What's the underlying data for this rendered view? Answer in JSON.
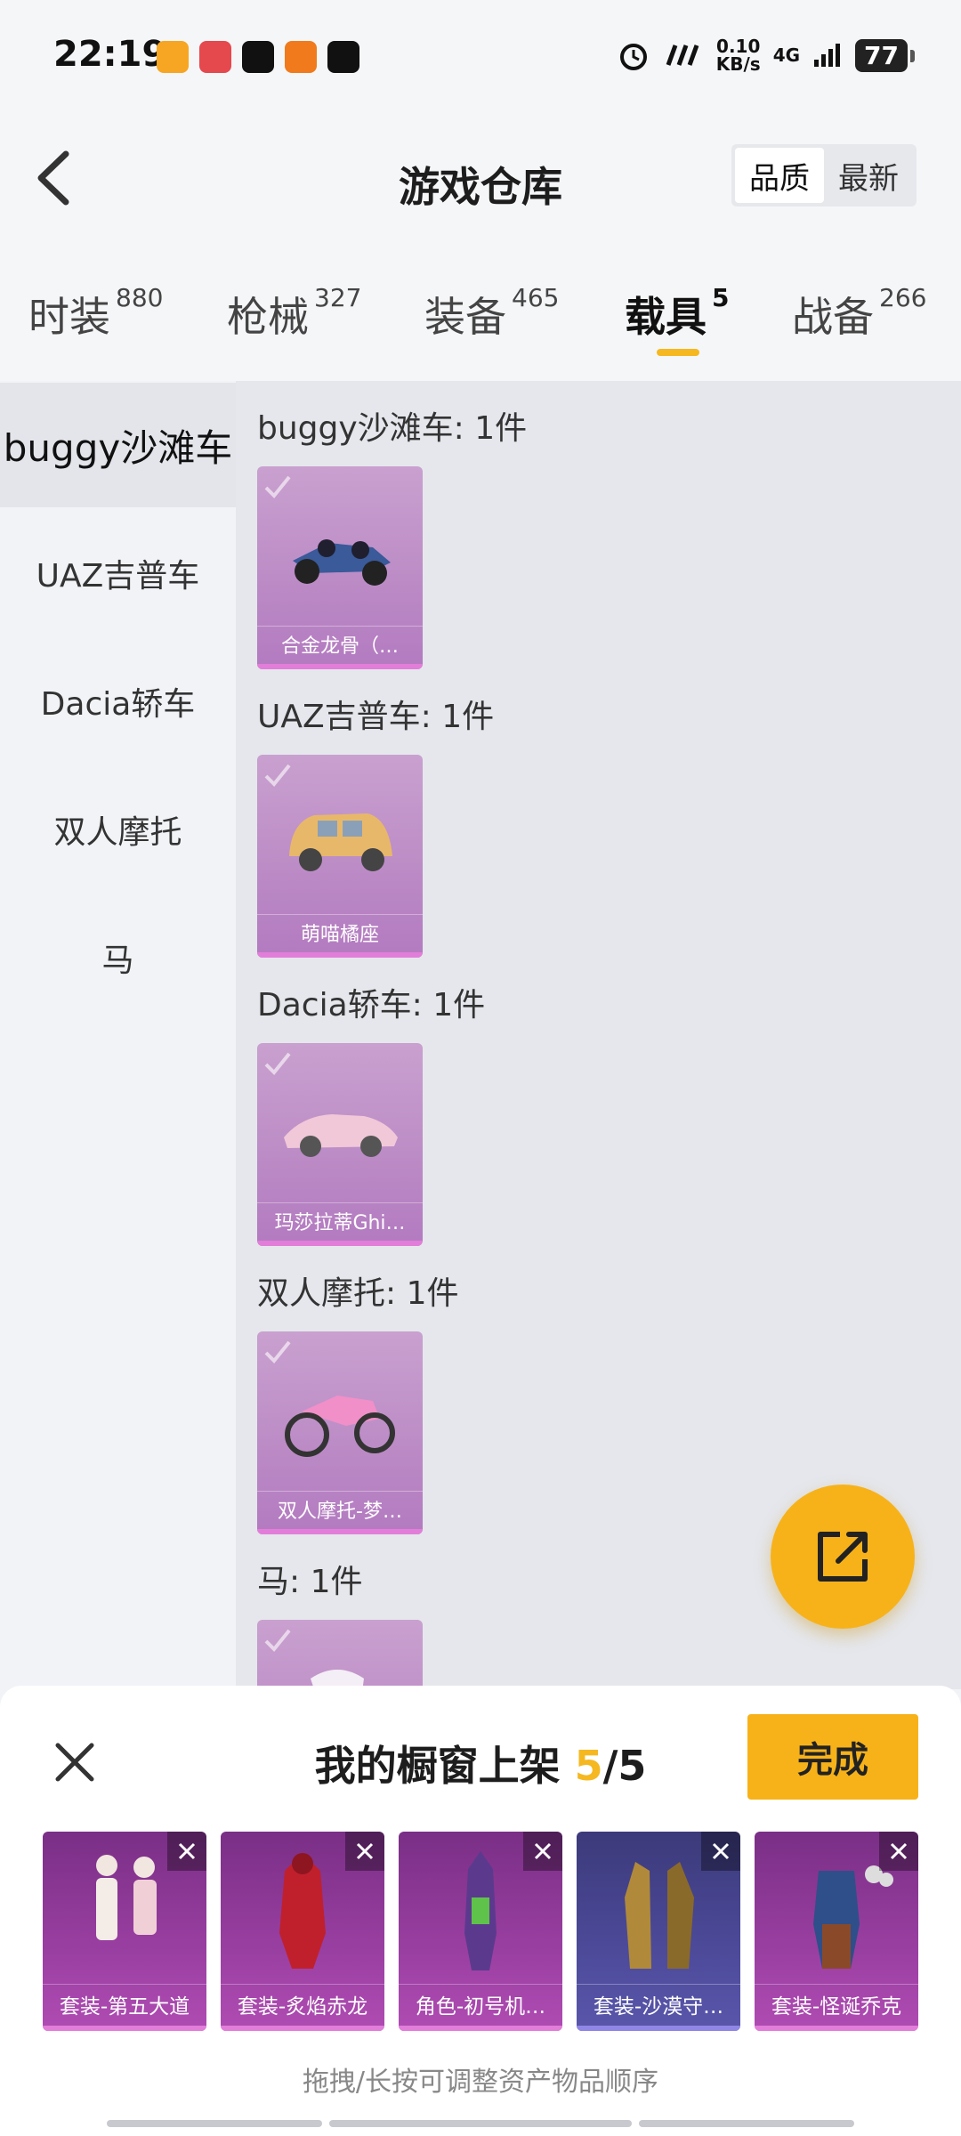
{
  "status_bar": {
    "time": "22:19",
    "net_speed_value": "0.10",
    "net_speed_unit": "KB/s",
    "network": "4G",
    "battery": "77"
  },
  "header": {
    "title": "游戏仓库",
    "sort_options": [
      "品质",
      "最新"
    ],
    "sort_selected": "品质"
  },
  "tabs": [
    {
      "label": "时装",
      "count": "880"
    },
    {
      "label": "枪械",
      "count": "327"
    },
    {
      "label": "装备",
      "count": "465"
    },
    {
      "label": "载具",
      "count": "5"
    },
    {
      "label": "战备",
      "count": "266"
    }
  ],
  "active_tab": "载具",
  "sidebar": {
    "items": [
      "buggy沙滩车",
      "UAZ吉普车",
      "Dacia轿车",
      "双人摩托",
      "马"
    ]
  },
  "groups": [
    {
      "title": "buggy沙滩车: 1件",
      "item": "合金龙骨（…"
    },
    {
      "title": "UAZ吉普车: 1件",
      "item": "萌喵橘座"
    },
    {
      "title": "Dacia轿车: 1件",
      "item": "玛莎拉蒂Ghi…"
    },
    {
      "title": "双人摩托: 1件",
      "item": "双人摩托-梦…"
    },
    {
      "title": "马: 1件",
      "item": ""
    }
  ],
  "sheet": {
    "title_prefix": "我的橱窗上架",
    "count_current": "5",
    "count_sep": "/",
    "count_total": "5",
    "done_label": "完成",
    "items": [
      "套装-第五大道",
      "套装-炙焰赤龙",
      "角色-初号机…",
      "套装-沙漠守…",
      "套装-怪诞乔克"
    ],
    "hint": "拖拽/长按可调整资产物品顺序"
  },
  "colors": {
    "accent": "#f7b21a",
    "card_purple": "#bc8cc6",
    "shelf_purple": "#9a3fa2",
    "shelf_blue": "#4d4a9a"
  },
  "icons": [
    "back-arrow-icon",
    "check-icon",
    "share-icon",
    "close-icon",
    "remove-icon"
  ]
}
